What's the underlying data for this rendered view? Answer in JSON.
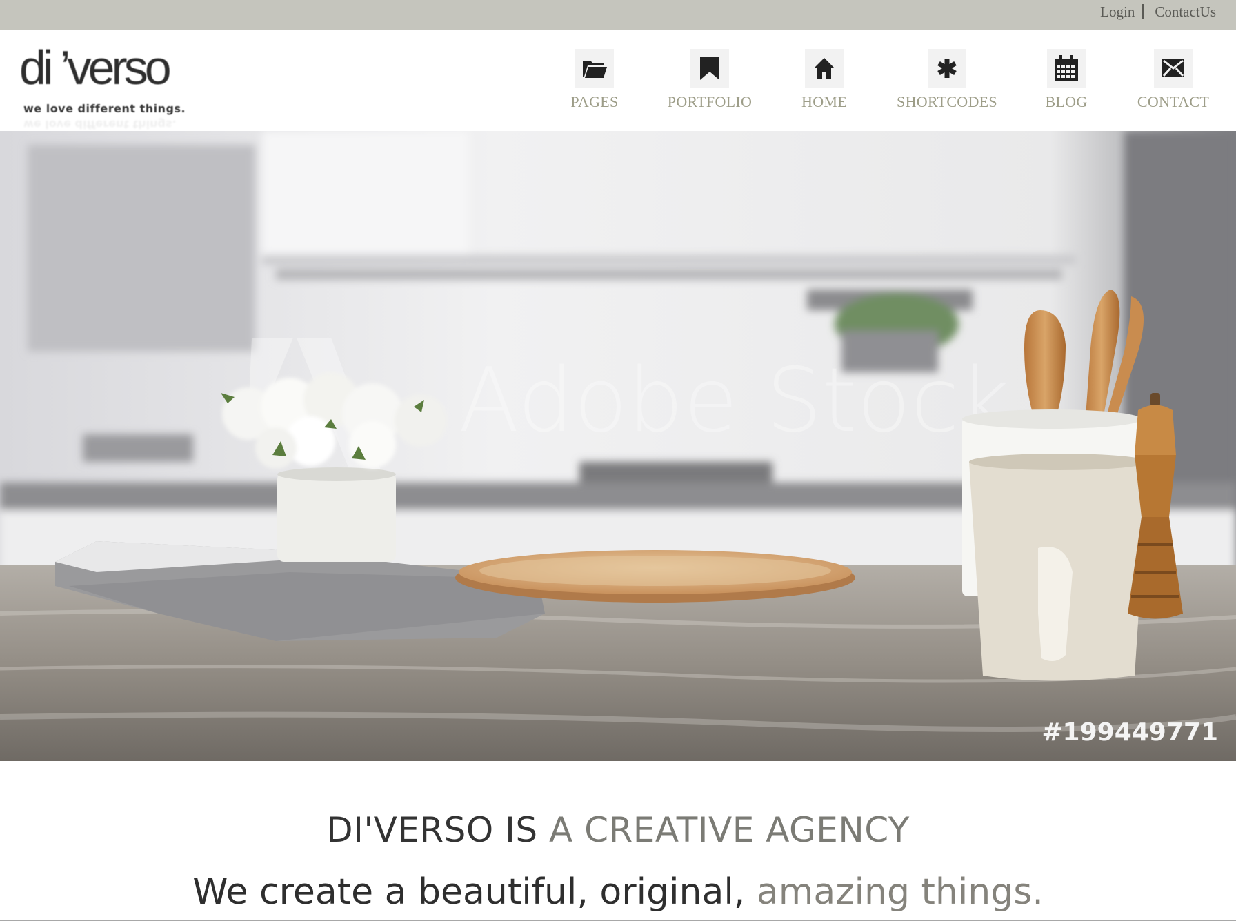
{
  "topbar": {
    "login": "Login",
    "contact": "ContactUs"
  },
  "logo": {
    "word": "di ’verso",
    "tagline": "we love different things."
  },
  "nav": [
    {
      "label": "PAGES",
      "icon": "folder-icon"
    },
    {
      "label": "PORTFOLIO",
      "icon": "bookmark-icon"
    },
    {
      "label": "HOME",
      "icon": "home-icon"
    },
    {
      "label": "SHORTCODES",
      "icon": "asterisk-icon"
    },
    {
      "label": "BLOG",
      "icon": "calendar-icon"
    },
    {
      "label": "CONTACT",
      "icon": "envelope-icon"
    }
  ],
  "hero": {
    "watermark": "Adobe Stock",
    "image_id": "#199449771"
  },
  "intro": {
    "heading_main": "DI'VERSO IS ",
    "heading_accent": "A CREATIVE AGENCY",
    "sub_main": "We create a beautiful, original, ",
    "sub_accent": "amazing things."
  },
  "colors": {
    "topbar": "#c5c5bd",
    "nav_label": "#9d9d88",
    "heading": "#333333",
    "accent": "#7b7b75"
  }
}
